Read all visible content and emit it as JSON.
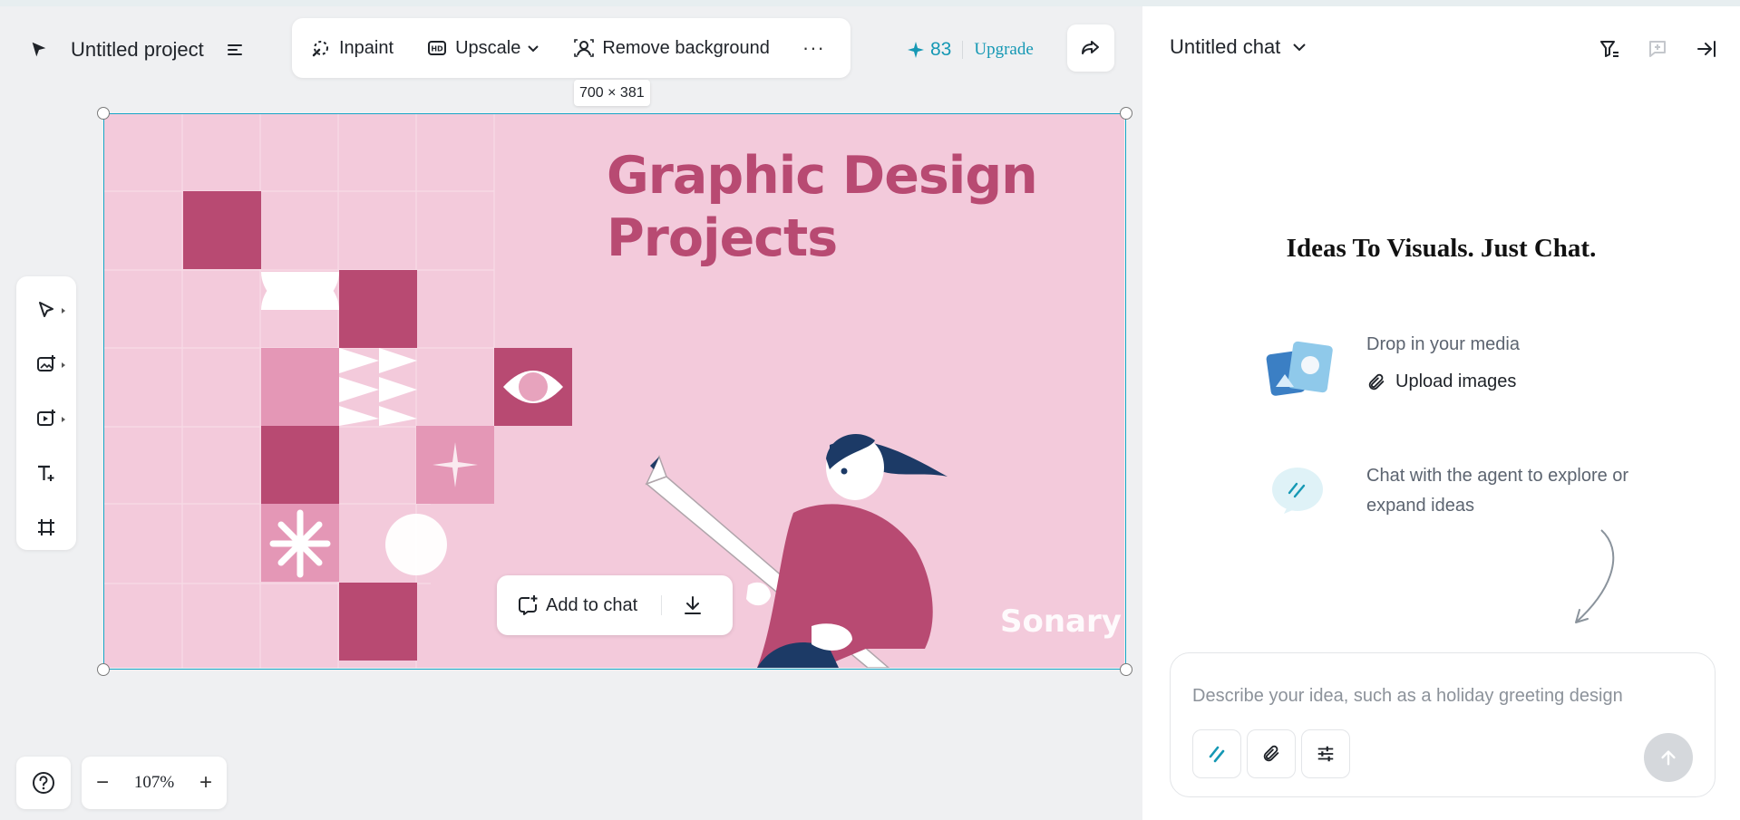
{
  "project": {
    "name": "Untitled project"
  },
  "toolbar": {
    "inpaint_label": "Inpaint",
    "upscale_label": "Upscale",
    "remove_bg_label": "Remove background",
    "more_label": "···"
  },
  "credits": {
    "count": "83",
    "upgrade_label": "Upgrade"
  },
  "canvas": {
    "dimensions_label": "700 × 381",
    "design_title_line1": "Graphic Design",
    "design_title_line2": "Projects",
    "design_brand": "Sonary",
    "add_to_chat_label": "Add to chat"
  },
  "zoom": {
    "minus": "−",
    "value": "107%",
    "plus": "+"
  },
  "chat": {
    "title": "Untitled chat",
    "tagline": "Ideas To Visuals. Just Chat.",
    "media_hint": "Drop in your media",
    "upload_label": "Upload images",
    "agent_hint": "Chat with the agent to explore or expand ideas",
    "input_placeholder": "Describe your idea, such as a holiday greeting design"
  },
  "colors": {
    "accent": "#1598b4",
    "selection": "#17a6c6",
    "design_bg": "#f3cadb",
    "design_primary": "#b84a72"
  },
  "icons": {
    "project_logo": "cursor-logo-icon",
    "menu": "menu-icon",
    "inpaint": "inpaint-icon",
    "upscale": "hd-icon",
    "remove_bg": "person-cutout-icon",
    "share": "share-icon",
    "rail": [
      "select-icon",
      "image-add-icon",
      "video-add-icon",
      "text-add-icon",
      "frame-icon"
    ],
    "help": "help-icon",
    "chat_header": [
      "filter-icon",
      "new-chat-icon",
      "collapse-panel-icon"
    ],
    "input": [
      "agent-icon",
      "attach-icon",
      "settings-sliders-icon",
      "send-icon"
    ]
  }
}
